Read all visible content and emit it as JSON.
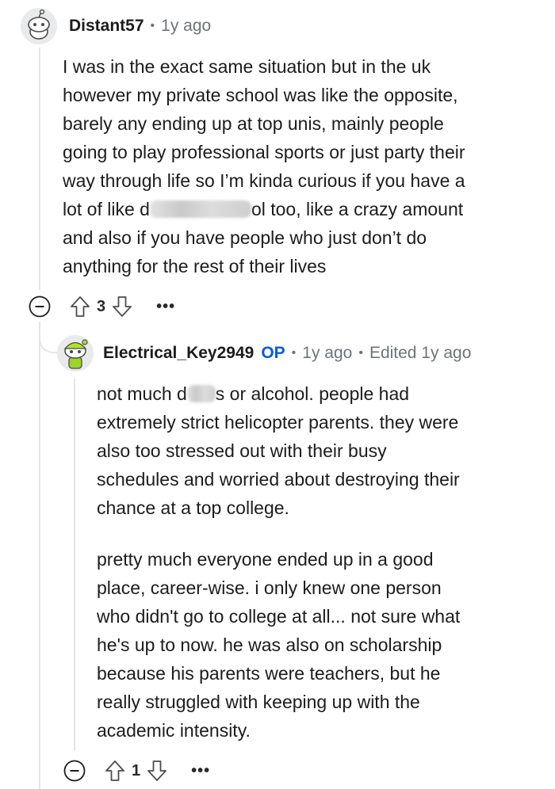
{
  "comments": [
    {
      "username": "Distant57",
      "time": "1y ago",
      "lines": [
        "I was in the exact same situation but in the uk",
        "however my private school was like the opposite,",
        "barely any ending up at top unis, mainly people",
        "going to play professional sports or just party their",
        "way through life so I’m kinda curious if you have a"
      ],
      "line6_start": "lot of like d",
      "line6_end": "ol too, like a crazy amount",
      "lines_after": [
        "and also if you have people who just don’t do",
        "anything for the rest of their lives"
      ],
      "votes": "3"
    },
    {
      "username": "Electrical_Key2949",
      "op_badge": "OP",
      "time": "1y ago",
      "edited": "Edited 1y ago",
      "line1_start": "not much d",
      "line1_end": "s or alcohol. people had",
      "p1_lines": [
        "extremely strict helicopter parents. they were",
        "also too stressed out with their busy",
        "schedules and worried about destroying their",
        "chance at a top college."
      ],
      "p2_lines": [
        "pretty much everyone ended up in a good",
        "place, career-wise. i only knew one person",
        "who didn't go to college at all... not sure what",
        "he's up to now. he was also on scholarship",
        "because his parents were teachers, but he",
        "really struggled with keeping up with the",
        "academic intensity."
      ],
      "votes": "1"
    }
  ],
  "separator": "•",
  "more_label": "•••",
  "icons": {
    "avatar1": "snoo-avatar-icon",
    "avatar2": "green-snoo-avatar-icon",
    "collapse": "collapse-minus-icon",
    "upvote": "upvote-arrow-icon",
    "downvote": "downvote-arrow-icon",
    "more": "more-options-icon"
  },
  "colors": {
    "op": "#0a5bd6",
    "meta": "#6e7378",
    "thread_line": "#e5e5e5"
  }
}
